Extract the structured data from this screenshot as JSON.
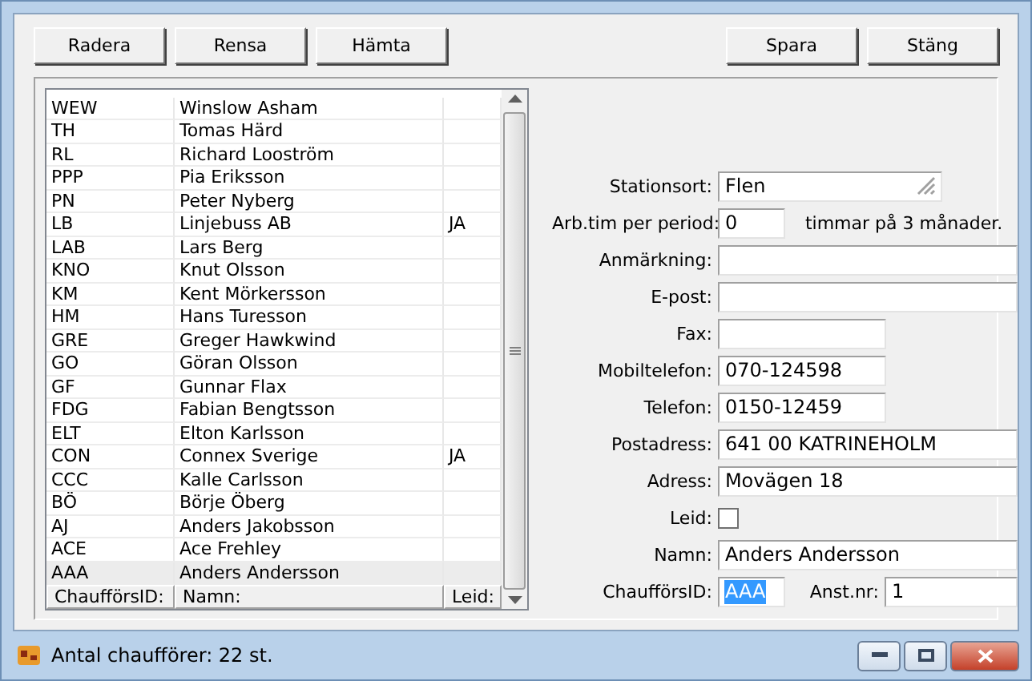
{
  "buttons": {
    "left": [
      "Radera",
      "Rensa",
      "Hämta"
    ],
    "right": [
      "Spara",
      "Stäng"
    ]
  },
  "list": {
    "rows": [
      {
        "id": "WEW",
        "name": "Winslow Asham",
        "selected": false
      },
      {
        "id": "TH",
        "name": "Tomas Härd",
        "selected": false
      },
      {
        "id": "RL",
        "name": "Richard Looström",
        "selected": false
      },
      {
        "id": "PPP",
        "name": "Pia Eriksson",
        "selected": false
      },
      {
        "id": "PN",
        "name": "Peter Nyberg",
        "selected": false
      },
      {
        "id": "LB",
        "name": "Linjebuss AB",
        "leid": "JA",
        "selected": false
      },
      {
        "id": "LAB",
        "name": "Lars Berg",
        "selected": false
      },
      {
        "id": "KNO",
        "name": "Knut Olsson",
        "selected": false
      },
      {
        "id": "KM",
        "name": "Kent Mörkersson",
        "selected": false
      },
      {
        "id": "HM",
        "name": "Hans Turesson",
        "selected": false
      },
      {
        "id": "GRE",
        "name": "Greger Hawkwind",
        "selected": false
      },
      {
        "id": "GO",
        "name": "Göran Olsson",
        "selected": false
      },
      {
        "id": "GF",
        "name": "Gunnar Flax",
        "selected": false
      },
      {
        "id": "FDG",
        "name": "Fabian Bengtsson",
        "selected": false
      },
      {
        "id": "ELT",
        "name": "Elton Karlsson",
        "selected": false
      },
      {
        "id": "CON",
        "name": "Connex Sverige",
        "leid": "JA",
        "selected": false
      },
      {
        "id": "CCC",
        "name": "Kalle Carlsson",
        "selected": false
      },
      {
        "id": "BÖ",
        "name": "Börje Öberg",
        "selected": false
      },
      {
        "id": "AJ",
        "name": "Anders Jakobsson",
        "selected": false
      },
      {
        "id": "ACE",
        "name": "Ace Frehley",
        "selected": false
      },
      {
        "id": "AAA",
        "name": "Anders Andersson",
        "selected": true
      }
    ],
    "columns": [
      "ChaufförsID:",
      "Namn:",
      "Leid:"
    ]
  },
  "form": {
    "fields": [
      {
        "kind": "select",
        "label": "Stationsort:",
        "value": "Flen"
      },
      {
        "kind": "hours",
        "label": "Arb.tim per period:",
        "value": "0",
        "suffix": "timmar på 3 månader."
      },
      {
        "kind": "wide",
        "label": "Anmärkning:"
      },
      {
        "kind": "wide",
        "label": "E-post:"
      },
      {
        "kind": "medium",
        "label": "Fax:"
      },
      {
        "kind": "medium",
        "label": "Mobiltelefon:",
        "value": "070-124598"
      },
      {
        "kind": "medium",
        "label": "Telefon:",
        "value": "0150-12459"
      },
      {
        "kind": "wide",
        "label": "Postadress:",
        "value": "641 00  KATRINEHOLM"
      },
      {
        "kind": "wide",
        "label": "Adress:",
        "value": "Movägen 18"
      },
      {
        "kind": "checkbox",
        "label": "Leid:",
        "checked": false
      },
      {
        "kind": "wide",
        "label": "Namn:",
        "value": "Anders Andersson"
      },
      {
        "kind": "pair",
        "label": "ChaufförsID:",
        "value": "AAA",
        "value_selected": true,
        "label_2": "Anst.nr:",
        "value_2": "1"
      }
    ]
  },
  "window": {
    "title": "Antal chaufförer: 22 st."
  }
}
